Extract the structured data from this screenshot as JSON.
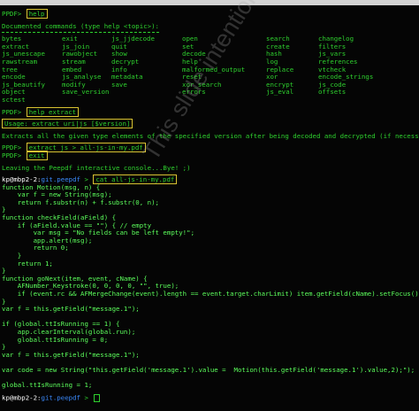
{
  "prompt1": {
    "prompt": "PPDF> ",
    "cmd": "help"
  },
  "doc_header": "Documented commands (type help <topic>):",
  "commands": [
    "bytes",
    "exit",
    "js_jjdecode",
    "open",
    "search",
    "changelog",
    "extract",
    "js_join",
    "quit",
    "set",
    "create",
    "filters",
    "js_unescape",
    "rawobject",
    "show",
    "decode",
    "hash",
    "js_vars",
    "rawstream",
    "stream",
    "decrypt",
    "help",
    "log",
    "references",
    "tree",
    "embed",
    "info",
    "malformed_output",
    "replace",
    "vtcheck",
    "encode",
    "js_analyse",
    "metadata",
    "reset",
    "xor",
    "encode_strings",
    "js_beautify",
    "modify",
    "save",
    "xor_search",
    "encrypt",
    "js_code",
    "object",
    "save_version",
    "",
    "errors",
    "js_eval",
    "offsets",
    "sctest",
    ""
  ],
  "prompt2": {
    "prompt": "PPDF> ",
    "cmd": "help extract"
  },
  "usage": "Usage: extract uri|js [$version]",
  "extract_desc": "Extracts all the given type elements of the specified version after being decoded and decrypted (if necessary)",
  "prompt3": {
    "prompt": "PPDF> ",
    "cmd": "extract js > all-js-in-my.pdf"
  },
  "prompt4": {
    "prompt": "PPDF> ",
    "cmd": "exit"
  },
  "leaving": "Leaving the Peepdf interactive console...Bye! ;)",
  "shell": {
    "user": "kp@mbp2-2",
    "sep": ":",
    "repo": "git.peepdf",
    "arrow": " > ",
    "cmd": "cat all-js-in-my.pdf"
  },
  "code": [
    "function Motion(msg, n) {",
    "    var f = new String(msg);",
    "    return f.substr(n) + f.substr(0, n);",
    "}",
    "function checkField(aField) {",
    "    if (aField.value == \"\") { // empty",
    "        var msg = \"No fields can be left empty!\";",
    "        app.alert(msg);",
    "        return 0;",
    "    }",
    "    return 1;",
    "}",
    "function goNext(item, event, cName) {",
    "    AFNumber_Keystroke(0, 0, 0, 0, \"\", true);",
    "    if (event.rc && AFMergeChange(event).length == event.target.charLimit) item.getField(cName).setFocus();",
    "}",
    "var f = this.getField(\"message.1\");",
    "",
    "if (global.ttIsRunning == 1) {",
    "    app.clearInterval(global.run);",
    "    global.ttIsRunning = 0;",
    "}",
    "var f = this.getField(\"message.1\");",
    "",
    "var code = new String(\"this.getField('message.1').value =  Motion(this.getField('message.1').value,2);\");",
    "",
    "global.ttIsRunning = 1;"
  ],
  "watermark": "This slide intentionally left"
}
